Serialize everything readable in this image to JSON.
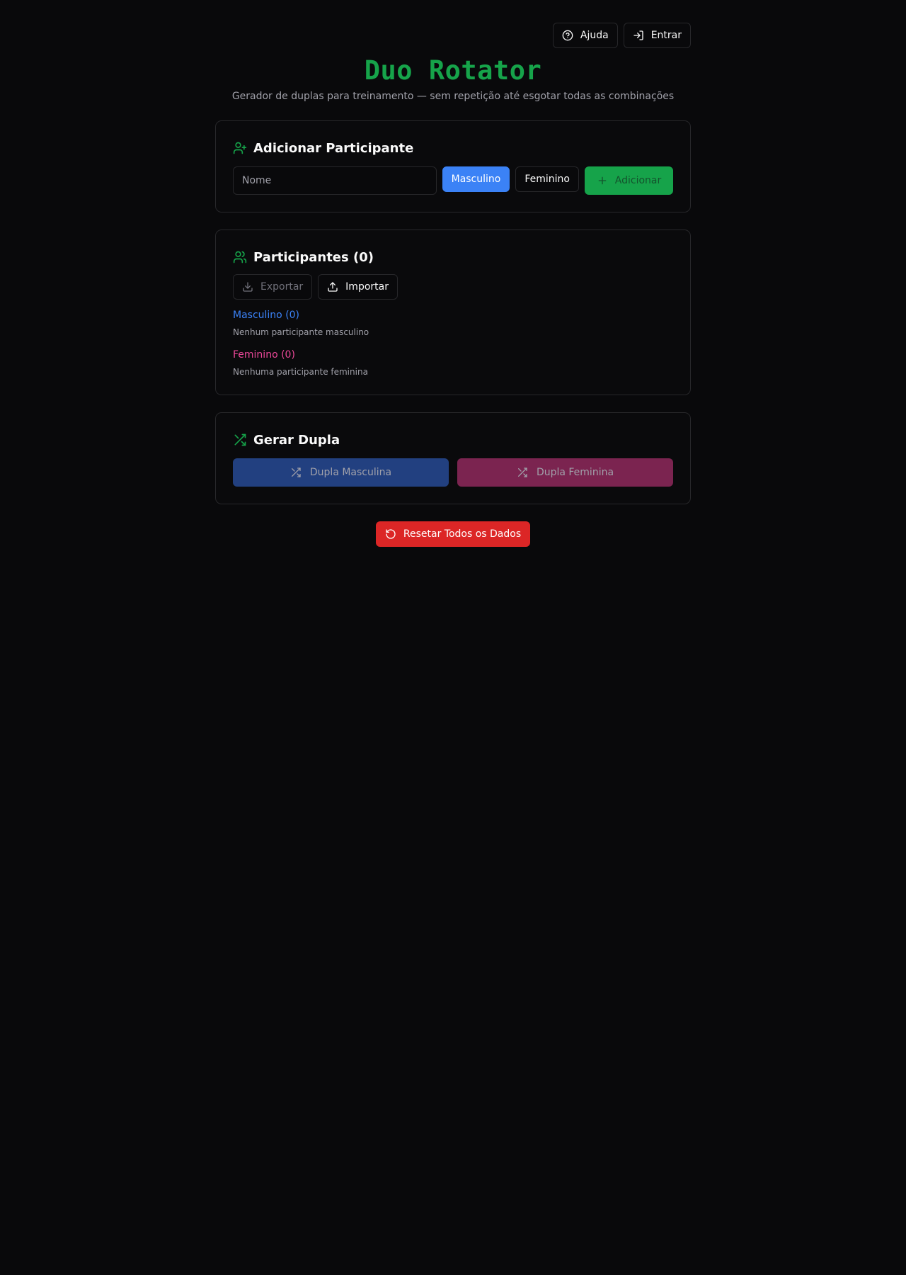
{
  "topbar": {
    "help_label": "Ajuda",
    "login_label": "Entrar"
  },
  "header": {
    "title": "Duo Rotator",
    "subtitle": "Gerador de duplas para treinamento — sem repetição até esgotar todas as combinações"
  },
  "add_participant": {
    "title": "Adicionar Participante",
    "name_placeholder": "Nome",
    "name_value": "",
    "male_label": "Masculino",
    "female_label": "Feminino",
    "selected_gender": "Masculino",
    "add_label": "Adicionar"
  },
  "participants": {
    "title": "Participantes (0)",
    "export_label": "Exportar",
    "import_label": "Importar",
    "male_group_label": "Masculino (0)",
    "male_empty_text": "Nenhum participante masculino",
    "female_group_label": "Feminino (0)",
    "female_empty_text": "Nenhuma participante feminina"
  },
  "generate": {
    "title": "Gerar Dupla",
    "male_pair_label": "Dupla Masculina",
    "female_pair_label": "Dupla Feminina"
  },
  "reset": {
    "label": "Resetar Todos os Dados"
  },
  "colors": {
    "accent_green": "#16a34a",
    "male_blue": "#3b82f6",
    "female_pink": "#ec4899",
    "danger_red": "#dc2626"
  },
  "icons": {
    "help": "help-circle-icon",
    "login": "log-in-icon",
    "add_user": "user-plus-icon",
    "plus": "plus-icon",
    "users": "users-icon",
    "download": "download-icon",
    "upload": "upload-icon",
    "shuffle": "shuffle-icon",
    "reset": "rotate-ccw-icon"
  }
}
